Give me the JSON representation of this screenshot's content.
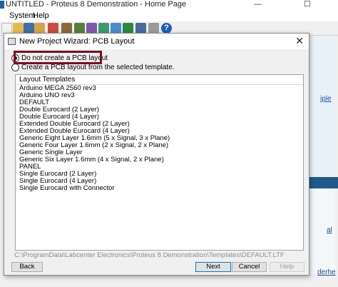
{
  "window": {
    "title": "UNTITLED - Proteus 8 Demonstration - Home Page",
    "minimize": "—",
    "restore": "☐"
  },
  "menu": [
    "System",
    "Help"
  ],
  "background": {
    "link_right_1": "iple",
    "link_right_2": "derhe",
    "link_right_3": "al"
  },
  "dialog": {
    "title": "New Project Wizard: PCB Layout",
    "close": "✕",
    "options": [
      {
        "label": "Do not create a PCB layout",
        "checked": true
      },
      {
        "label": "Create a PCB layout from the selected template.",
        "checked": false
      }
    ],
    "list_header": "Layout Templates",
    "templates": [
      "Arduino MEGA 2560 rev3",
      "Arduino UNO rev3",
      "DEFAULT",
      "Double Eurocard (2 Layer)",
      "Double Eurocard (4 Layer)",
      "Extended Double Eurocard (2 Layer)",
      "Extended Double Eurocard (4 Layer)",
      "Generic Eight Layer 1.6mm (5 x Signal, 3 x Plane)",
      "Generic Four Layer 1.6mm (2 x Signal, 2 x Plane)",
      "Generic Single Layer",
      "Generic Six Layer 1.6mm (4 x Signal, 2 x Plane)",
      "PANEL",
      "Single Eurocard (2 Layer)",
      "Single Eurocard (4 Layer)",
      "Single Eurocard with Connector"
    ],
    "path": "C:\\ProgramData\\Labcenter Electronics\\Proteus 8 Demonstration\\Templates\\DEFAULT.LTF",
    "buttons": {
      "back": "Back",
      "next": "Next",
      "cancel": "Cancel",
      "help": "Help"
    }
  },
  "colors": {
    "highlight_box": "#7a0d22",
    "accent": "#0078d7"
  }
}
